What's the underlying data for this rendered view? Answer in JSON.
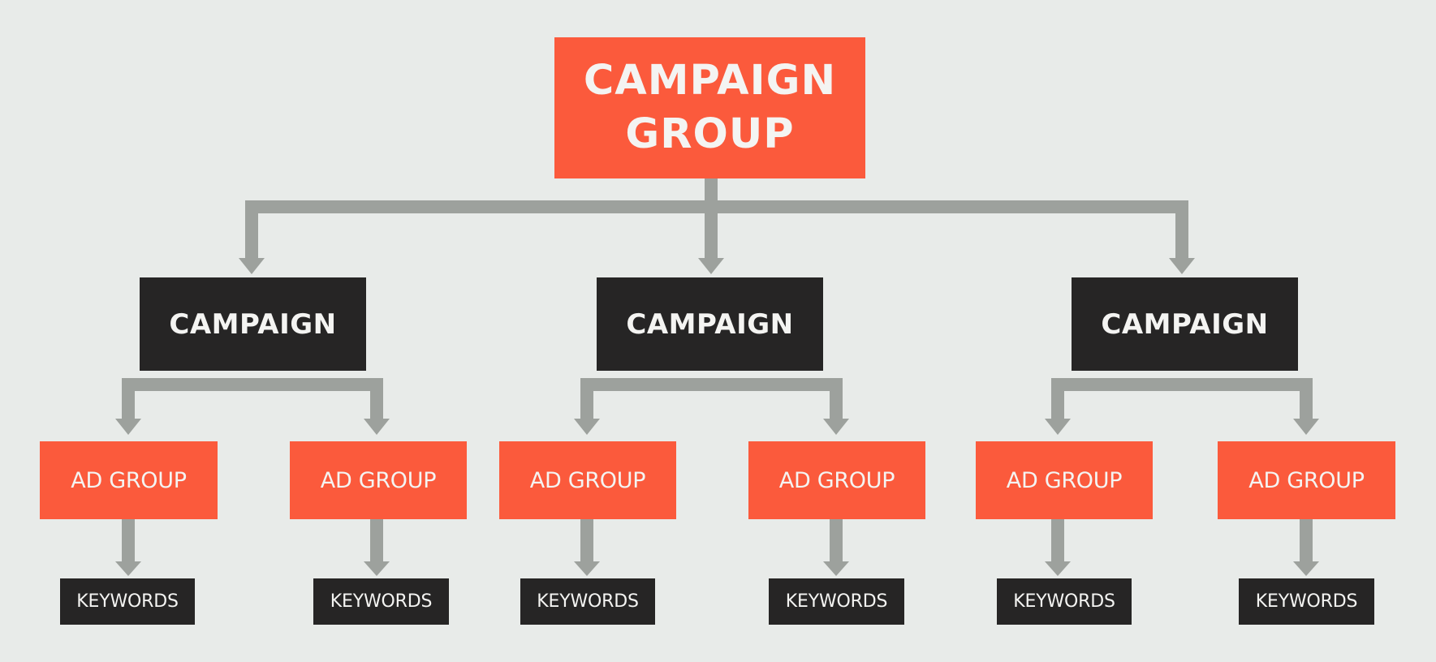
{
  "diagram": {
    "root": {
      "label": "CAMPAIGN\nGROUP"
    },
    "campaigns": [
      {
        "label": "CAMPAIGN",
        "ad_groups": [
          {
            "label": "AD GROUP",
            "keywords": "KEYWORDS"
          },
          {
            "label": "AD GROUP",
            "keywords": "KEYWORDS"
          }
        ]
      },
      {
        "label": "CAMPAIGN",
        "ad_groups": [
          {
            "label": "AD GROUP",
            "keywords": "KEYWORDS"
          },
          {
            "label": "AD GROUP",
            "keywords": "KEYWORDS"
          }
        ]
      },
      {
        "label": "CAMPAIGN",
        "ad_groups": [
          {
            "label": "AD GROUP",
            "keywords": "KEYWORDS"
          },
          {
            "label": "AD GROUP",
            "keywords": "KEYWORDS"
          }
        ]
      }
    ]
  },
  "colors": {
    "background": "#e8ebe9",
    "accent": "#fb5a3c",
    "dark": "#262525",
    "connector": "#9da19d",
    "text": "#f4f4f2"
  }
}
